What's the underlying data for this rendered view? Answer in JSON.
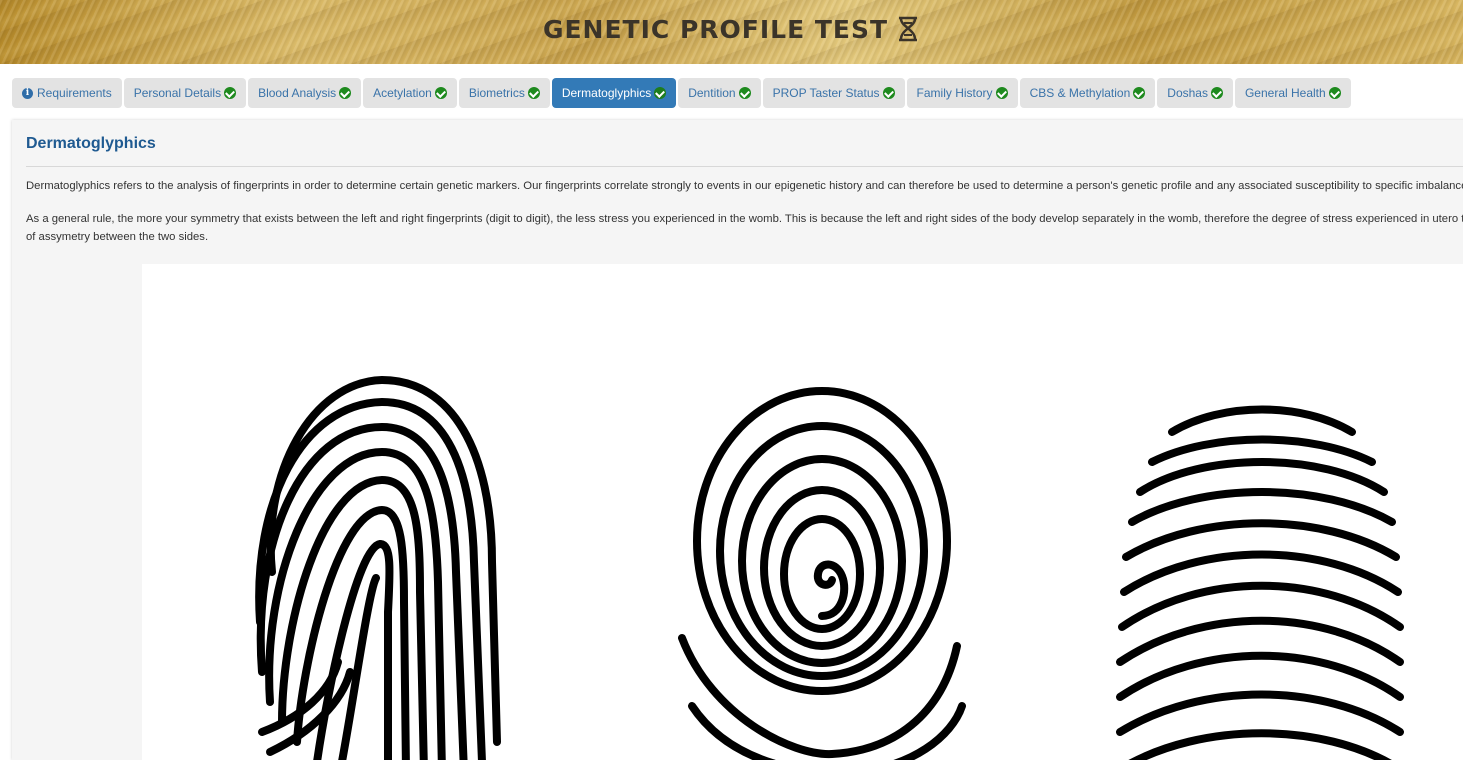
{
  "header": {
    "title": "GENETIC PROFILE TEST",
    "icon": "dna-icon"
  },
  "tabs": [
    {
      "label": "Requirements",
      "icon": "info-icon",
      "active": false
    },
    {
      "label": "Personal Details",
      "icon": "check-icon",
      "active": false
    },
    {
      "label": "Blood Analysis",
      "icon": "check-icon",
      "active": false
    },
    {
      "label": "Acetylation",
      "icon": "check-icon",
      "active": false
    },
    {
      "label": "Biometrics",
      "icon": "check-icon",
      "active": false
    },
    {
      "label": "Dermatoglyphics",
      "icon": "check-icon",
      "active": true
    },
    {
      "label": "Dentition",
      "icon": "check-icon",
      "active": false
    },
    {
      "label": "PROP Taster Status",
      "icon": "check-icon",
      "active": false
    },
    {
      "label": "Family History",
      "icon": "check-icon",
      "active": false
    },
    {
      "label": "CBS & Methylation",
      "icon": "check-icon",
      "active": false
    },
    {
      "label": "Doshas",
      "icon": "check-icon",
      "active": false
    },
    {
      "label": "General Health",
      "icon": "check-icon",
      "active": false
    }
  ],
  "colors": {
    "accent": "#337ab7",
    "check": "#1e8a1e",
    "title": "#1f5a91"
  },
  "panel": {
    "title": "Dermatoglyphics",
    "paragraph1": "Dermatoglyphics refers to the analysis of fingerprints in order to determine certain genetic markers. Our fingerprints correlate strongly to events in our epigenetic history and can therefore be used to determine a person's genetic profile and any associated susceptibility to specific imbalances",
    "paragraph2_line1": "As a general rule, the more your symmetry that exists between the left and right fingerprints (digit to digit), the less stress you experienced in the womb. This is because the left and right sides of the body develop separately in the womb, therefore the degree of stress experienced in utero te",
    "paragraph2_line2": "of assymetry between the two sides.",
    "fingerprints": [
      "loop-fingerprint-icon",
      "whorl-fingerprint-icon",
      "arch-fingerprint-icon"
    ]
  }
}
